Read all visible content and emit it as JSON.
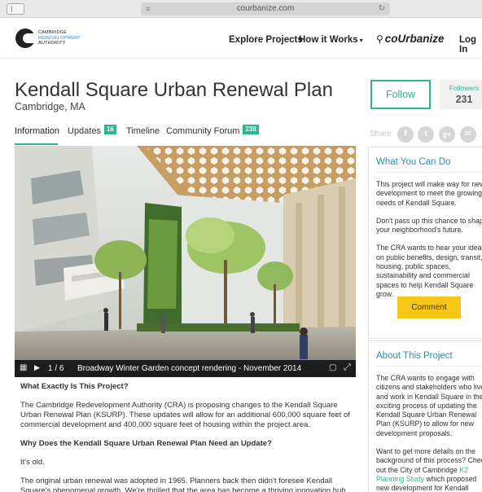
{
  "browser": {
    "url": "courbanize.com",
    "menu_icon": "hamburger-icon",
    "reload_icon": "reload-icon"
  },
  "header": {
    "logo": {
      "line1": "CAMBRIDGE",
      "line2": "REDEVELOPMENT",
      "line3": "AUTHORITY"
    },
    "nav": {
      "explore": "Explore Projects",
      "how": "How it Works",
      "how_caret": "▾",
      "brand": "coUrbanize",
      "login": "Log In"
    }
  },
  "project": {
    "title": "Kendall Square Urban Renewal Plan",
    "location": "Cambridge, MA",
    "follow_label": "Follow",
    "followers_label": "Followers",
    "followers_count": "231"
  },
  "tabs": [
    {
      "label": "Information",
      "badge": ""
    },
    {
      "label": "Updates",
      "badge": "16"
    },
    {
      "label": "Timeline",
      "badge": ""
    },
    {
      "label": "Community Forum",
      "badge": "238"
    }
  ],
  "share": {
    "label": "Share",
    "icons": [
      "facebook-icon",
      "twitter-icon",
      "google-plus-icon",
      "email-icon"
    ],
    "glyphs": [
      "f",
      "t",
      "g+",
      "✉"
    ]
  },
  "gallery": {
    "position": "1 / 6",
    "caption": "Broadway Winter Garden concept rendering - November 2014"
  },
  "article": {
    "q1": "What Exactly Is This Project?",
    "p1": "The Cambridge Redevelopment Authority (CRA) is proposing changes to the Kendall Square Urban Renewal Plan (KSURP). These updates will allow for an additional 600,000 square feet of commercial development and 400,000 square feet of housing within the project area.",
    "q2": "Why Does the Kendall Square Urban Renewal Plan Need an Update?",
    "p2": "It's old.",
    "p3": "The original urban renewal was adopted in 1965. Planners back then didn't foresee Kendall Square's phenomenal growth. We're thrilled that the area has become a thriving innovation hub, but a decades-old"
  },
  "sidebar": {
    "what_you_can_do": {
      "title": "What You Can Do",
      "p1": "This project will make way for new development to meet the growing needs of Kendall Square.",
      "p2": "Don't pass up this chance to shape your neighborhood's future.",
      "p3": "The CRA wants to hear your ideas on public benefits, design, transit, housing, public spaces, sustainability and commercial spaces to help Kendall Square grow.",
      "button": "Comment"
    },
    "about": {
      "title": "About This Project",
      "p1": "The CRA wants to engage with citizens and stakeholders who live and work in Kendall Square in the exciting process of updating the Kendall Square Urban Renewal Plan (KSURP) to allow for new development proposals.",
      "p2_before": "Want to get more details on the background of this process? Check out the City of Cambridge ",
      "p2_link": "K2 Planning Study",
      "p2_after": " which proposed new development for Kendall Square."
    }
  },
  "colors": {
    "accent_green": "#2fb392",
    "link_blue": "#2f8eb6",
    "comment_yellow": "#f7c617"
  }
}
